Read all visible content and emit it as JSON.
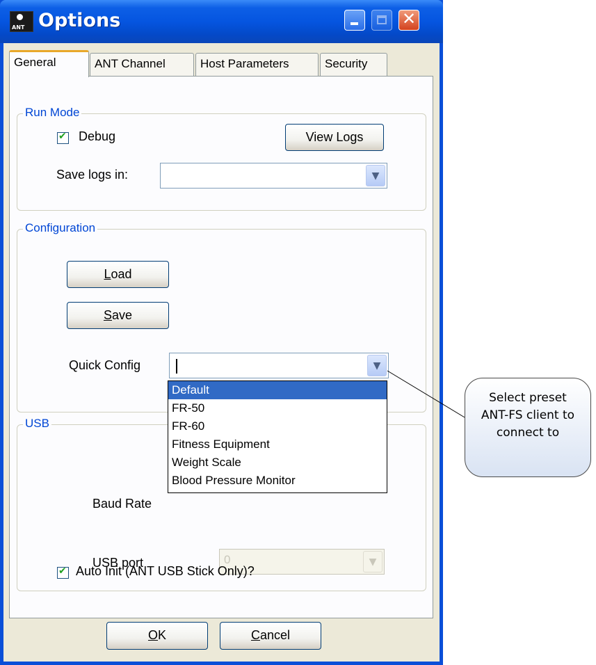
{
  "window": {
    "title": "Options",
    "app_icon_text": "ANT"
  },
  "titlebar_buttons": {
    "close_glyph": "✕"
  },
  "tabs": [
    {
      "label": "General",
      "active": true
    },
    {
      "label": "ANT Channel",
      "active": false
    },
    {
      "label": "Host Parameters",
      "active": false
    },
    {
      "label": "Security",
      "active": false
    }
  ],
  "run_mode": {
    "group_label": "Run Mode",
    "debug_label": "Debug",
    "debug_checked": true,
    "view_logs_label": "View Logs",
    "save_logs_label": "Save logs in:",
    "save_logs_value": ""
  },
  "configuration": {
    "group_label": "Configuration",
    "load_label_mnemonic": "L",
    "load_label_rest": "oad",
    "save_label_mnemonic": "S",
    "save_label_rest": "ave",
    "quick_config_label": "Quick Config",
    "quick_config_value": "",
    "options": [
      "Default",
      "FR-50",
      "FR-60",
      "Fitness Equipment",
      "Weight Scale",
      "Blood Pressure Monitor"
    ],
    "selected_option": "Default"
  },
  "usb": {
    "group_label": "USB",
    "baud_rate_label": "Baud Rate",
    "usb_port_label": "USB port",
    "usb_port_value": "0",
    "auto_init_label": "Auto Init (ANT USB Stick Only)?",
    "auto_init_checked": true
  },
  "footer": {
    "ok_mnemonic": "O",
    "ok_rest": "K",
    "cancel_mnemonic": "C",
    "cancel_rest": "ancel"
  },
  "callout": {
    "lines": [
      "Select preset",
      "ANT-FS client to",
      "connect to"
    ]
  },
  "colors": {
    "titlebar": "#0555e0",
    "group_label": "#0046d5",
    "selection": "#316ac5",
    "dialog_bg": "#ece9d8"
  }
}
